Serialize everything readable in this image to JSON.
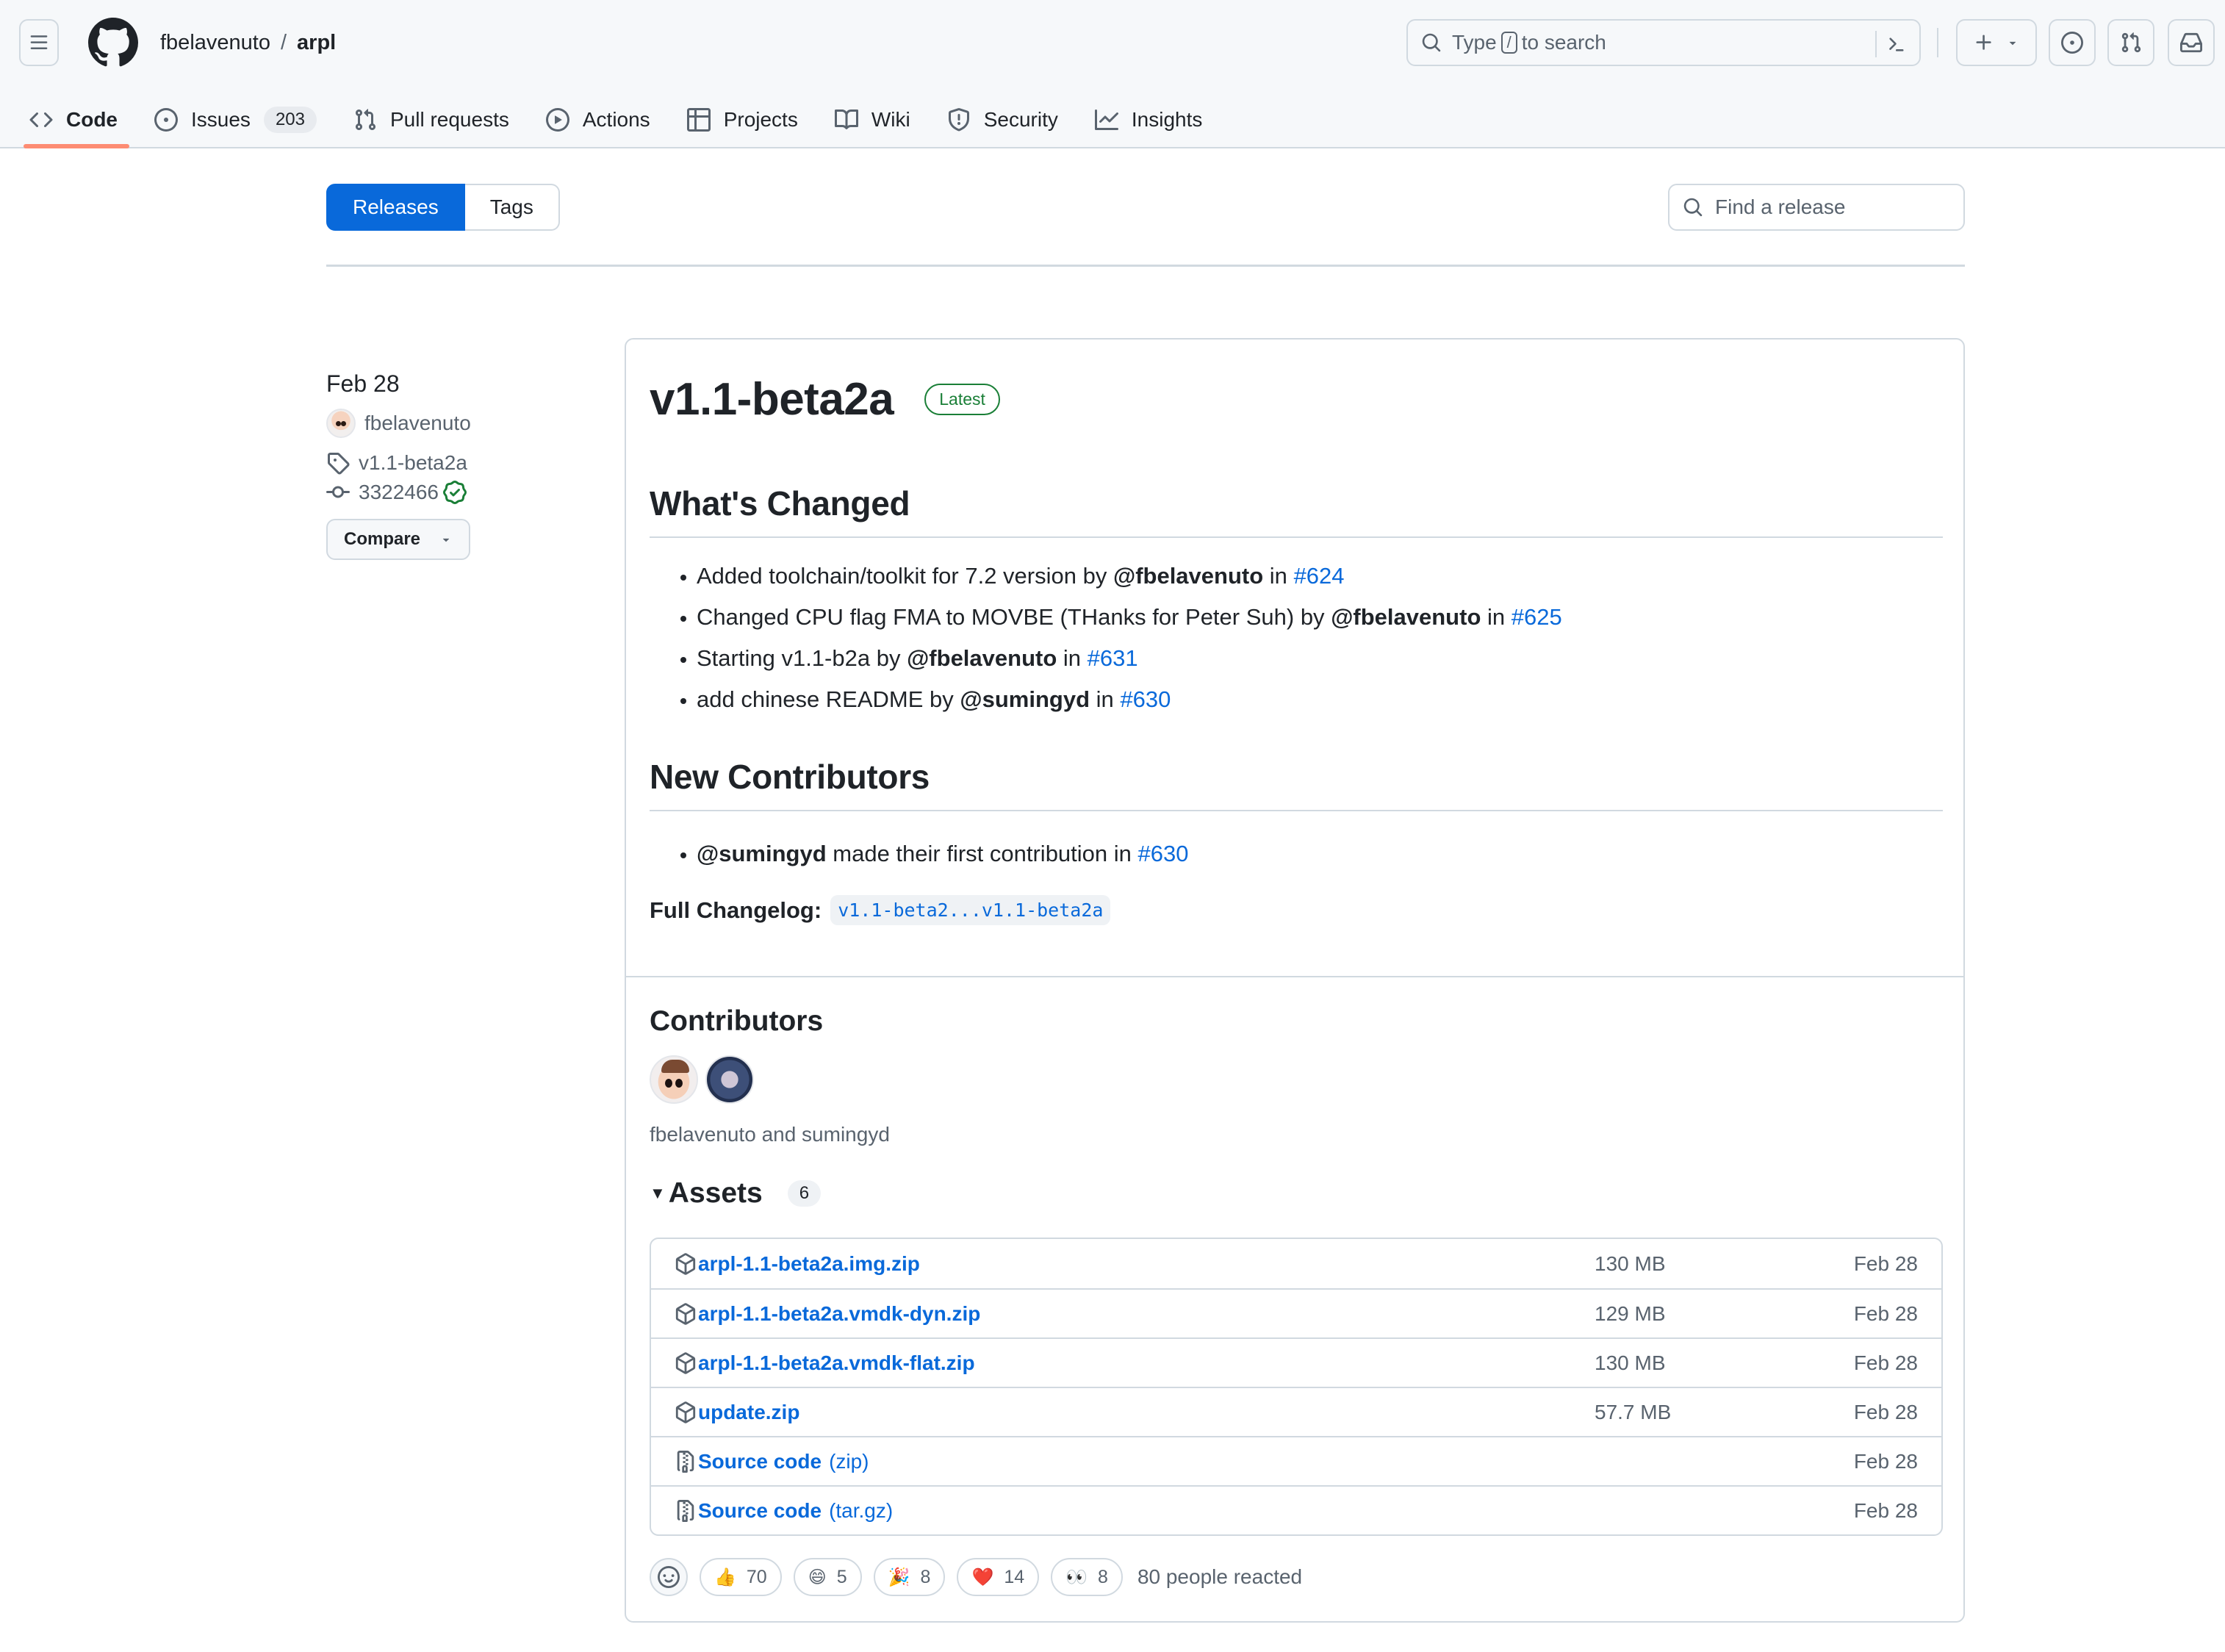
{
  "header": {
    "owner": "fbelavenuto",
    "separator": "/",
    "repo": "arpl",
    "search": {
      "prefix": "Type",
      "key": "/",
      "suffix": "to search"
    }
  },
  "repo_nav": {
    "items": [
      {
        "label": "Code",
        "icon": "code-icon",
        "active": true
      },
      {
        "label": "Issues",
        "icon": "issue-opened-icon",
        "count": "203"
      },
      {
        "label": "Pull requests",
        "icon": "git-pull-request-icon"
      },
      {
        "label": "Actions",
        "icon": "play-icon"
      },
      {
        "label": "Projects",
        "icon": "table-icon"
      },
      {
        "label": "Wiki",
        "icon": "book-icon"
      },
      {
        "label": "Security",
        "icon": "shield-icon"
      },
      {
        "label": "Insights",
        "icon": "graph-icon"
      }
    ]
  },
  "subnav": {
    "releases_label": "Releases",
    "tags_label": "Tags",
    "find_placeholder": "Find a release"
  },
  "sidebar": {
    "date": "Feb 28",
    "author": "fbelavenuto",
    "tag": "v1.1-beta2a",
    "commit": "3322466",
    "compare_label": "Compare"
  },
  "release": {
    "title": "v1.1-beta2a",
    "badge": "Latest",
    "whats_changed_heading": "What's Changed",
    "changes": [
      {
        "text": "Added toolchain/toolkit for 7.2 version by",
        "mention": "@fbelavenuto",
        "in": "in",
        "pr": "#624"
      },
      {
        "text": "Changed CPU flag FMA to MOVBE (THanks for Peter Suh) by",
        "mention": "@fbelavenuto",
        "in": "in",
        "pr": "#625"
      },
      {
        "text": "Starting v1.1-b2a by",
        "mention": "@fbelavenuto",
        "in": "in",
        "pr": "#631"
      },
      {
        "text": "add chinese README by",
        "mention": "@sumingyd",
        "in": "in",
        "pr": "#630"
      }
    ],
    "new_contributors_heading": "New Contributors",
    "new_contributors": [
      {
        "mention": "@sumingyd",
        "text": "made their first contribution in",
        "pr": "#630"
      }
    ],
    "full_changelog_label": "Full Changelog:",
    "full_changelog_link": "v1.1-beta2...v1.1-beta2a",
    "contributors_heading": "Contributors",
    "contributors_names": "fbelavenuto and sumingyd",
    "assets_heading": "Assets",
    "assets_count": "6",
    "assets": [
      {
        "name": "arpl-1.1-beta2a.img.zip",
        "suffix": "",
        "size": "130 MB",
        "date": "Feb 28",
        "icon": "package-icon"
      },
      {
        "name": "arpl-1.1-beta2a.vmdk-dyn.zip",
        "suffix": "",
        "size": "129 MB",
        "date": "Feb 28",
        "icon": "package-icon"
      },
      {
        "name": "arpl-1.1-beta2a.vmdk-flat.zip",
        "suffix": "",
        "size": "130 MB",
        "date": "Feb 28",
        "icon": "package-icon"
      },
      {
        "name": "update.zip",
        "suffix": "",
        "size": "57.7 MB",
        "date": "Feb 28",
        "icon": "package-icon"
      },
      {
        "name": "Source code",
        "suffix": "(zip)",
        "size": "",
        "date": "Feb 28",
        "icon": "file-zip-icon"
      },
      {
        "name": "Source code",
        "suffix": "(tar.gz)",
        "size": "",
        "date": "Feb 28",
        "icon": "file-zip-icon"
      }
    ],
    "reactions": [
      {
        "emoji": "👍",
        "name": "thumbs-up",
        "count": "70"
      },
      {
        "emoji": "😄",
        "name": "laugh",
        "count": "5"
      },
      {
        "emoji": "🎉",
        "name": "hooray",
        "count": "8"
      },
      {
        "emoji": "❤️",
        "name": "heart",
        "count": "14"
      },
      {
        "emoji": "👀",
        "name": "eyes",
        "count": "8"
      }
    ],
    "reactions_summary": "80 people reacted"
  },
  "colors": {
    "accent": "#0969da",
    "success": "#1a7f37",
    "nav_underline": "#fd8c73",
    "muted": "#59636e",
    "border": "#d1d9e0"
  }
}
